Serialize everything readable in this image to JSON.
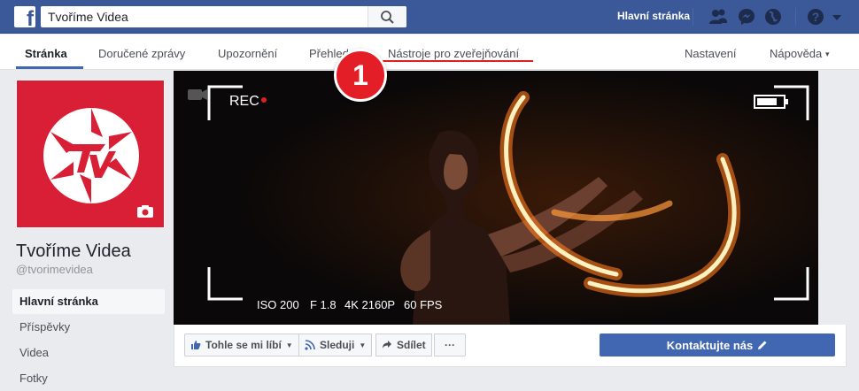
{
  "topbar": {
    "search_value": "Tvoříme Videa",
    "home_label": "Hlavní stránka"
  },
  "pagenav": {
    "tabs": [
      {
        "label": "Stránka"
      },
      {
        "label": "Doručené zprávy"
      },
      {
        "label": "Upozornění"
      },
      {
        "label": "Přehledy"
      },
      {
        "label": "Nástroje pro zveřejňování"
      }
    ],
    "settings_label": "Nastavení",
    "help_label": "Nápověda",
    "help_caret": "▾"
  },
  "annotation": {
    "number": "1",
    "color": "#e41e26"
  },
  "page": {
    "name": "Tvoříme Videa",
    "handle": "@tvorimevidea",
    "sidebar": [
      {
        "label": "Hlavní stránka"
      },
      {
        "label": "Příspěvky"
      },
      {
        "label": "Videa"
      },
      {
        "label": "Fotky"
      }
    ]
  },
  "cover": {
    "rec_label": "REC",
    "iso": "ISO 200",
    "aperture": "F 1.8",
    "resolution": "4K 2160P",
    "fps": "60 FPS"
  },
  "actions": {
    "like": "Tohle se mi líbí",
    "follow": "Sleduji",
    "share": "Sdílet",
    "more": "···",
    "contact": "Kontaktujte nás"
  },
  "colors": {
    "brand": "#3b5998",
    "accent": "#4267b2",
    "avatar_bg": "#d81f35"
  }
}
